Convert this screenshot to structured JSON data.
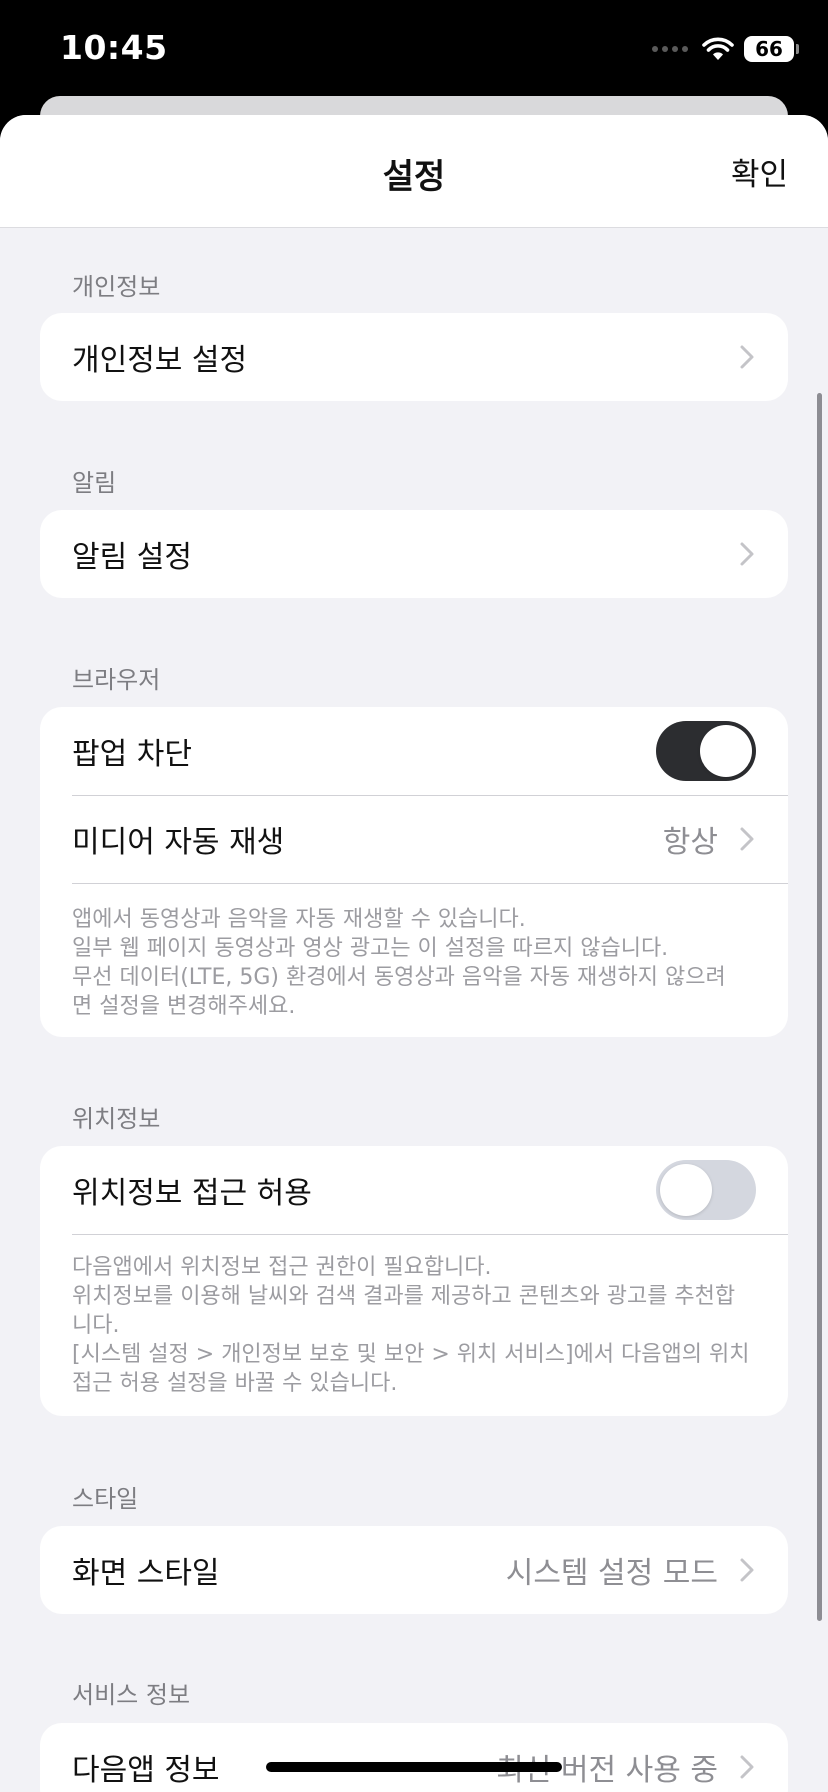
{
  "status_bar": {
    "time": "10:45",
    "battery": "66"
  },
  "nav": {
    "title": "설정",
    "confirm": "확인"
  },
  "sections": {
    "privacy": {
      "header": "개인정보",
      "row_label": "개인정보 설정"
    },
    "notifications": {
      "header": "알림",
      "row_label": "알림 설정"
    },
    "browser": {
      "header": "브라우저",
      "popup_label": "팝업 차단",
      "popup_on": true,
      "autoplay_label": "미디어 자동 재생",
      "autoplay_value": "항상",
      "description": [
        "앱에서 동영상과 음악을 자동 재생할 수 있습니다.",
        "일부 웹 페이지 동영상과 영상 광고는 이 설정을 따르지 않습니다.",
        "무선 데이터(LTE, 5G) 환경에서 동영상과 음악을 자동 재생하지 않으려",
        "면 설정을 변경해주세요."
      ]
    },
    "location": {
      "header": "위치정보",
      "row_label": "위치정보 접근 허용",
      "toggle_on": false,
      "description": [
        "다음앱에서 위치정보 접근 권한이 필요합니다.",
        "위치정보를 이용해 날씨와 검색 결과를 제공하고 콘텐츠와 광고를 추천합",
        "니다.",
        "[시스템 설정 > 개인정보 보호 및 보안 > 위치 서비스]에서 다음앱의 위치",
        "접근 허용 설정을 바꿀 수 있습니다."
      ]
    },
    "style": {
      "header": "스타일",
      "row_label": "화면 스타일",
      "row_value": "시스템 설정 모드"
    },
    "service": {
      "header": "서비스 정보",
      "row_label": "다음앱 정보",
      "row_value": "최신 버전 사용 중"
    }
  },
  "colors": {
    "toggle_on": "#2c2d30",
    "toggle_off": "#d4d7df",
    "background": "#f2f2f6"
  }
}
